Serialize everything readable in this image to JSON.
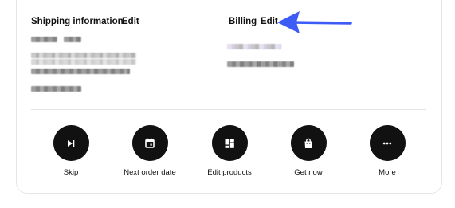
{
  "shipping": {
    "title": "Shipping information",
    "edit_label": "Edit"
  },
  "billing": {
    "title": "Billing",
    "edit_label": "Edit"
  },
  "colors": {
    "arrow": "#3d5cf5",
    "action_circle": "#111111",
    "divider": "#e4e4e4"
  },
  "actions": [
    {
      "label": "Skip",
      "icon": "skip-next-icon"
    },
    {
      "label": "Next order date",
      "icon": "calendar-icon"
    },
    {
      "label": "Edit products",
      "icon": "dashboard-grid-icon"
    },
    {
      "label": "Get now",
      "icon": "shopping-bag-icon"
    },
    {
      "label": "More",
      "icon": "more-dots-icon"
    }
  ]
}
